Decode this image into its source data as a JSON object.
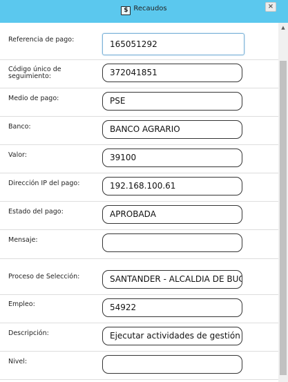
{
  "window": {
    "title": "Recaudos",
    "icon": "dollar-icon",
    "icon_glyph": "$",
    "close_glyph": "×"
  },
  "form": {
    "fields": [
      {
        "label": "Referencia de pago:",
        "value": "165051292"
      },
      {
        "label": "Código único de seguimiento:",
        "value": "372041851"
      },
      {
        "label": "Medio de pago:",
        "value": "PSE"
      },
      {
        "label": "Banco:",
        "value": "BANCO AGRARIO"
      },
      {
        "label": "Valor:",
        "value": "39100"
      },
      {
        "label": "Dirección IP del pago:",
        "value": "192.168.100.61"
      },
      {
        "label": "Estado del pago:",
        "value": "APROBADA"
      },
      {
        "label": "Mensaje:",
        "value": ""
      },
      {
        "label": "Proceso de Selección:",
        "value": "SANTANDER - ALCALDIA DE BUCARAMANGA"
      },
      {
        "label": "Empleo:",
        "value": "54922"
      },
      {
        "label": "Descripción:",
        "value": "Ejecutar actividades de gestión"
      },
      {
        "label": "Nivel:",
        "value": ""
      }
    ]
  },
  "colors": {
    "titlebar": "#5bc8ee",
    "input_border": "#333333",
    "focused_border": "#7bb2d8",
    "row_divider": "#dddddd"
  }
}
